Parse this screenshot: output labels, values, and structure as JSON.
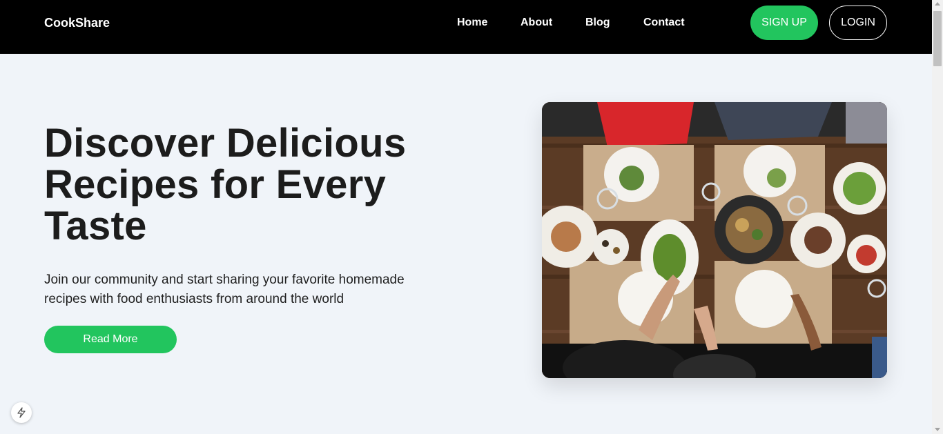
{
  "nav": {
    "brand": "CookShare",
    "links": [
      "Home",
      "About",
      "Blog",
      "Contact"
    ],
    "signup_label": "SIGN UP",
    "login_label": "LOGIN"
  },
  "hero": {
    "title": "Discover Delicious Recipes for Every Taste",
    "subtitle": "Join our community and start sharing your favorite homemade recipes with food enthusiasts from around the world",
    "cta_label": "Read More",
    "image_icon": "dining-table-photo"
  },
  "colors": {
    "accent": "#22c55e",
    "nav_bg": "#000000",
    "page_bg": "#f0f4f9",
    "text": "#1c1c1c"
  },
  "icons": {
    "dev_badge": "lightning-icon"
  }
}
